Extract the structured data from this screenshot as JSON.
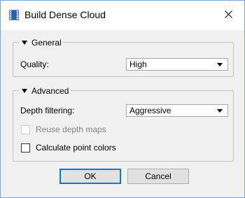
{
  "window": {
    "title": "Build Dense Cloud"
  },
  "icons": {
    "app": "film-strip-icon",
    "close": "close-icon"
  },
  "general": {
    "header": "General",
    "quality_label": "Quality:",
    "quality_value": "High"
  },
  "advanced": {
    "header": "Advanced",
    "depth_filtering_label": "Depth filtering:",
    "depth_filtering_value": "Aggressive",
    "reuse_depth_maps_label": "Reuse depth maps",
    "reuse_depth_maps_checked": false,
    "reuse_depth_maps_enabled": false,
    "calc_point_colors_label": "Calculate point colors",
    "calc_point_colors_checked": false
  },
  "buttons": {
    "ok": "OK",
    "cancel": "Cancel"
  },
  "colors": {
    "window_border": "#7aa7d6",
    "dialog_bg": "#f0f0f0",
    "default_button_border": "#0078d7",
    "icon_blue": "#4a7fc1"
  }
}
